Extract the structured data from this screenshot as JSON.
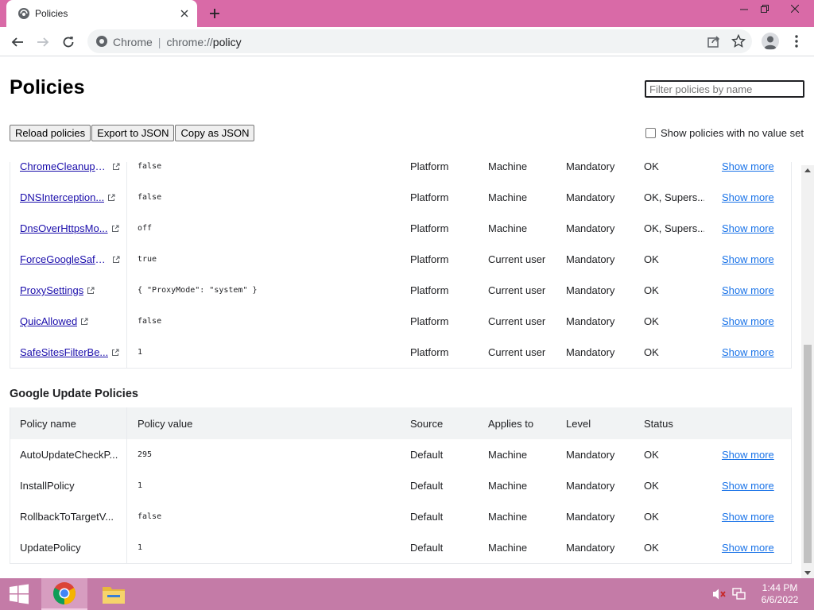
{
  "tab": {
    "title": "Policies",
    "favicon": "policy-favicon-icon"
  },
  "omnibox": {
    "scheme_label": "Chrome",
    "url_prefix": "chrome://",
    "url_path": "policy"
  },
  "page": {
    "title": "Policies",
    "filter_placeholder": "Filter policies by name",
    "buttons": {
      "reload": "Reload policies",
      "export": "Export to JSON",
      "copy": "Copy as JSON"
    },
    "show_no_value": "Show policies with no value set"
  },
  "chrome_policies": [
    {
      "name": "ChromeCleanupR...",
      "value": "false",
      "source": "Platform",
      "applies": "Machine",
      "level": "Mandatory",
      "status": "OK",
      "more": "Show more"
    },
    {
      "name": "DNSInterception...",
      "value": "false",
      "source": "Platform",
      "applies": "Machine",
      "level": "Mandatory",
      "status": "OK, Supers...",
      "more": "Show more"
    },
    {
      "name": "DnsOverHttpsMo...",
      "value": "off",
      "source": "Platform",
      "applies": "Machine",
      "level": "Mandatory",
      "status": "OK, Supers...",
      "more": "Show more"
    },
    {
      "name": "ForceGoogleSafe...",
      "value": "true",
      "source": "Platform",
      "applies": "Current user",
      "level": "Mandatory",
      "status": "OK",
      "more": "Show more"
    },
    {
      "name": "ProxySettings",
      "value": "{ \"ProxyMode\": \"system\" }",
      "source": "Platform",
      "applies": "Current user",
      "level": "Mandatory",
      "status": "OK",
      "more": "Show more"
    },
    {
      "name": "QuicAllowed",
      "value": "false",
      "source": "Platform",
      "applies": "Current user",
      "level": "Mandatory",
      "status": "OK",
      "more": "Show more"
    },
    {
      "name": "SafeSitesFilterBe...",
      "value": "1",
      "source": "Platform",
      "applies": "Current user",
      "level": "Mandatory",
      "status": "OK",
      "more": "Show more"
    }
  ],
  "google_update": {
    "title": "Google Update Policies",
    "headers": {
      "name": "Policy name",
      "value": "Policy value",
      "source": "Source",
      "applies": "Applies to",
      "level": "Level",
      "status": "Status"
    },
    "rows": [
      {
        "name": "AutoUpdateCheckP...",
        "value": "295",
        "source": "Default",
        "applies": "Machine",
        "level": "Mandatory",
        "status": "OK",
        "more": "Show more"
      },
      {
        "name": "InstallPolicy",
        "value": "1",
        "source": "Default",
        "applies": "Machine",
        "level": "Mandatory",
        "status": "OK",
        "more": "Show more"
      },
      {
        "name": "RollbackToTargetV...",
        "value": "false",
        "source": "Default",
        "applies": "Machine",
        "level": "Mandatory",
        "status": "OK",
        "more": "Show more"
      },
      {
        "name": "UpdatePolicy",
        "value": "1",
        "source": "Default",
        "applies": "Machine",
        "level": "Mandatory",
        "status": "OK",
        "more": "Show more"
      }
    ]
  },
  "taskbar": {
    "time": "1:44 PM",
    "date": "6/6/2022"
  },
  "colors": {
    "tabstrip": "#d96aa7",
    "taskbar": "#c47ba7",
    "link": "#1a0dab",
    "show_more": "#1a73e8"
  }
}
